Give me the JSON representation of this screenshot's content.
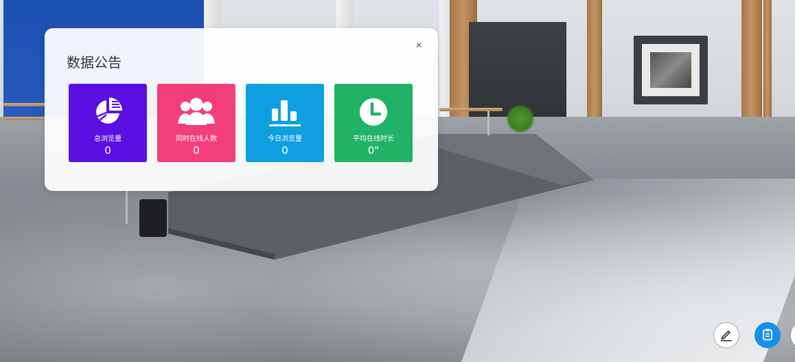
{
  "notice_panel": {
    "title": "数据公告",
    "close_label": "×"
  },
  "stats": [
    {
      "label": "总浏览量",
      "value": "0",
      "icon": "pie-chart-icon",
      "color": "#5b0fe3"
    },
    {
      "label": "同时在线人数",
      "value": "0",
      "icon": "users-icon",
      "color": "#f23e7a"
    },
    {
      "label": "今日浏览量",
      "value": "0",
      "icon": "bar-chart-icon",
      "color": "#0e9fe0"
    },
    {
      "label": "平均在线时长",
      "value": "0\"",
      "icon": "clock-icon",
      "color": "#22b266"
    }
  ],
  "floating_buttons": {
    "edit": {
      "icon": "pen-icon"
    },
    "notice": {
      "icon": "clipboard-icon",
      "color": "#1890e8"
    }
  }
}
